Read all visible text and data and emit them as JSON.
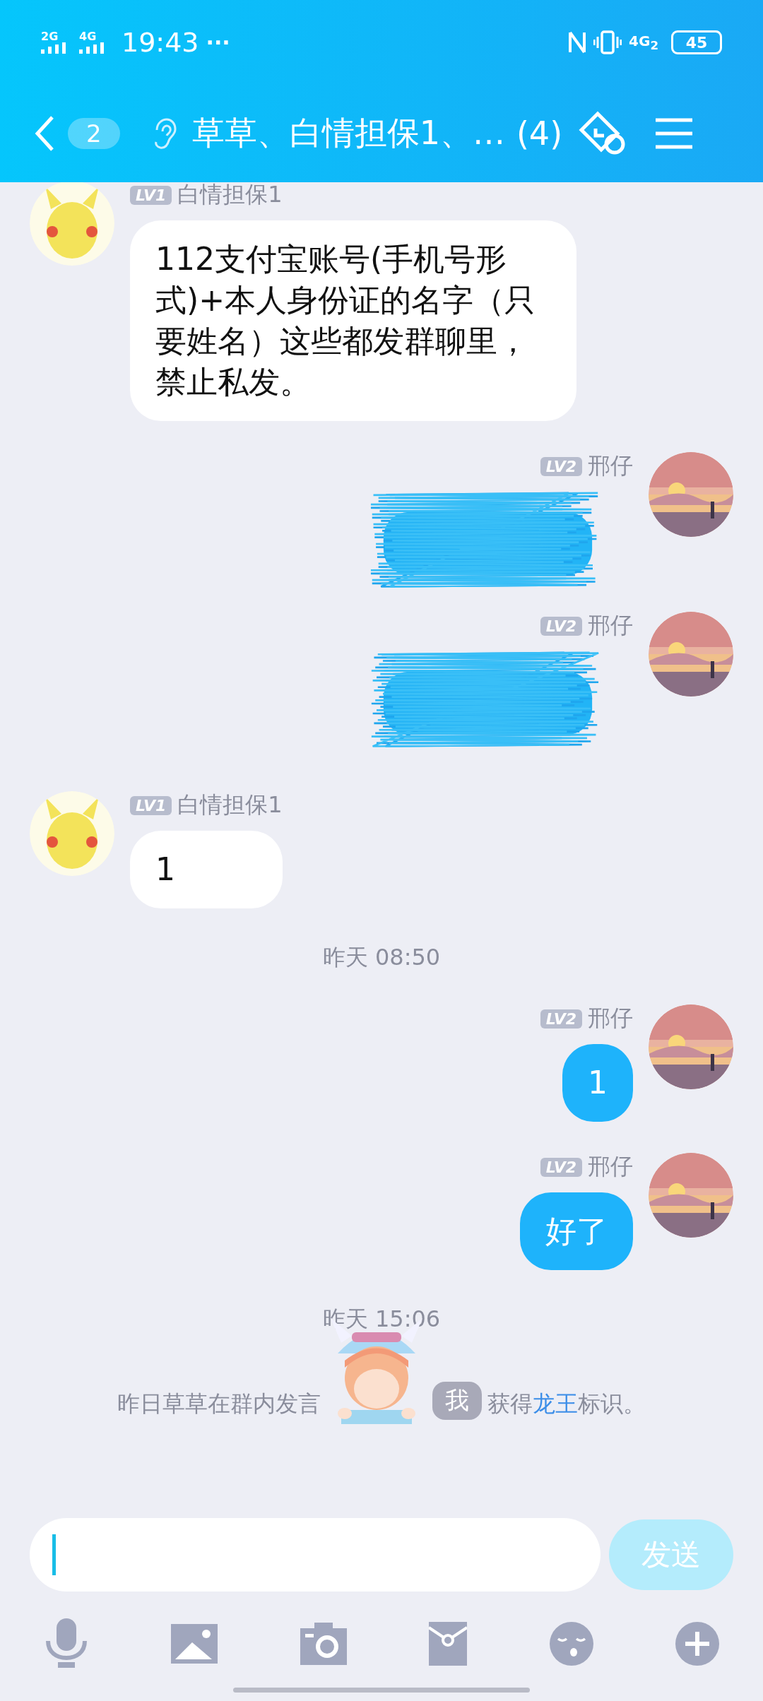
{
  "status_bar": {
    "signal_labels": [
      "2G",
      "4G"
    ],
    "time": "19:43",
    "more": "···",
    "network": "4G$_{2}$",
    "battery": "45"
  },
  "header": {
    "unread": "2",
    "title": "草草、白情担保1、…",
    "member_count": "(4)"
  },
  "messages": [
    {
      "kind": "text",
      "outgoing": false,
      "level": "LV1",
      "name": "白情担保1",
      "text": "112支付宝账号(手机号形式)+本人身份证的名字（只要姓名）这些都发群聊里，禁止私发。"
    },
    {
      "kind": "redacted",
      "outgoing": true,
      "level": "LV2",
      "name": "邢仔"
    },
    {
      "kind": "redacted",
      "outgoing": true,
      "level": "LV2",
      "name": "邢仔"
    },
    {
      "kind": "text",
      "outgoing": false,
      "level": "LV1",
      "name": "白情担保1",
      "text": "1"
    },
    {
      "kind": "time",
      "text": "昨天 08:50"
    },
    {
      "kind": "text",
      "outgoing": true,
      "level": "LV2",
      "name": "邢仔",
      "text": "1"
    },
    {
      "kind": "text",
      "outgoing": true,
      "level": "LV2",
      "name": "邢仔",
      "text": "好了"
    },
    {
      "kind": "time",
      "text": "昨天 15:06"
    },
    {
      "kind": "system",
      "before": "昨日草草在群内发言",
      "after": "获得",
      "link": "龙王",
      "tail": "标识。",
      "badge": "我"
    }
  ],
  "composer": {
    "send": "发送"
  }
}
